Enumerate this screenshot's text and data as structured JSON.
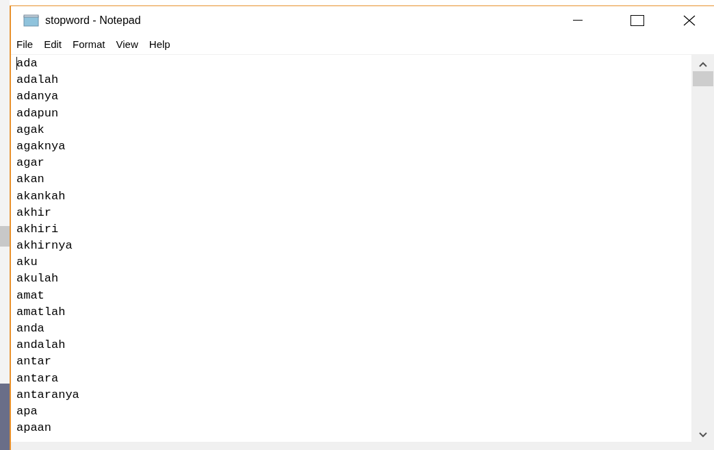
{
  "window": {
    "title": "stopword - Notepad"
  },
  "menu": [
    "File",
    "Edit",
    "Format",
    "View",
    "Help"
  ],
  "lines": [
    "ada",
    "adalah",
    "adanya",
    "adapun",
    "agak",
    "agaknya",
    "agar",
    "akan",
    "akankah",
    "akhir",
    "akhiri",
    "akhirnya",
    "aku",
    "akulah",
    "amat",
    "amatlah",
    "anda",
    "andalah",
    "antar",
    "antara",
    "antaranya",
    "apa",
    "apaan"
  ]
}
